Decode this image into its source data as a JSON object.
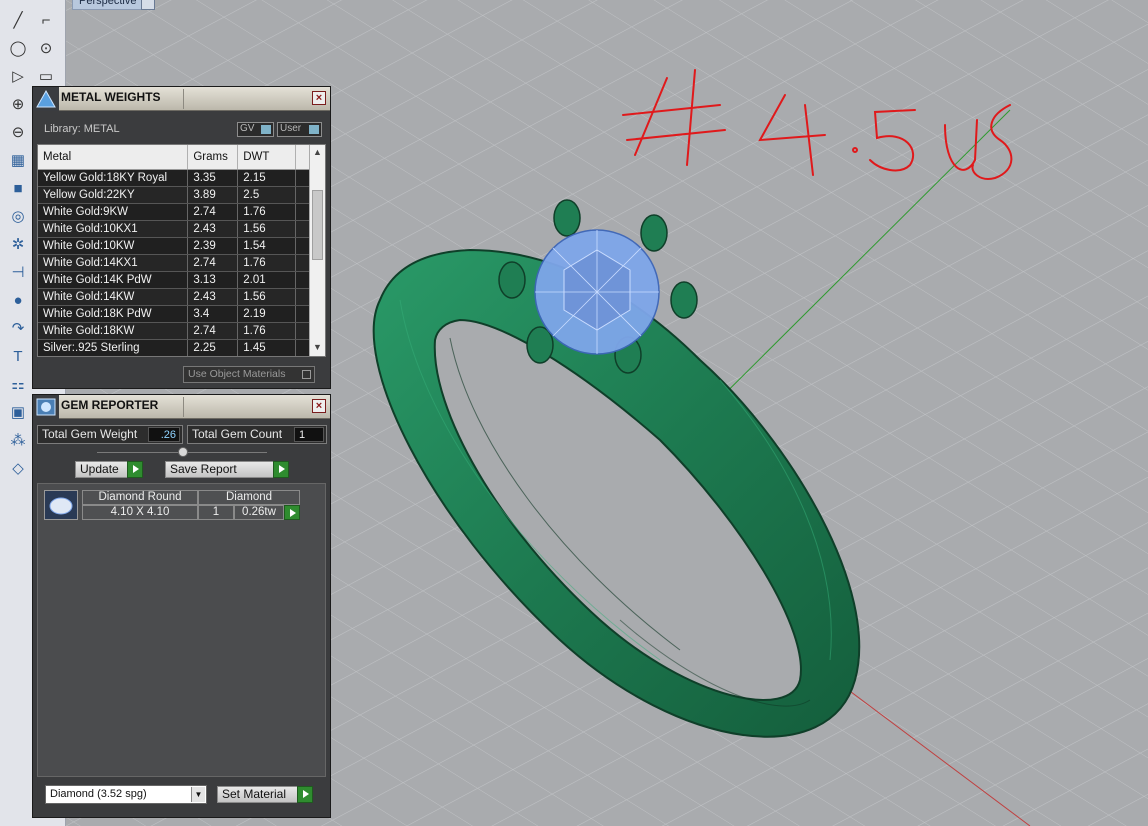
{
  "viewport": {
    "label": "Perspective",
    "annotation": "#4.5US"
  },
  "toolbar": {
    "icons": [
      "polyline-icon",
      "control-points-icon",
      "circle-icon",
      "arc-circle-icon",
      "curve-icon",
      "rectangle-icon",
      "circle-target-icon",
      "ellipse-icon",
      "surface-icon",
      "box-icon",
      "cylinder-icon",
      "gear-icon",
      "transform-icon",
      "boolean-icon",
      "curve-tool-icon",
      "text-icon",
      "array-icon",
      "solid-icon",
      "grid-icon",
      "gem-icon",
      "shape-icon"
    ]
  },
  "metal_panel": {
    "title": "METAL WEIGHTS",
    "library_label": "Library: METAL",
    "gv_label": "GV",
    "user_label": "User",
    "columns": [
      "Metal",
      "Grams",
      "DWT"
    ],
    "rows": [
      [
        "Yellow Gold:18KY Royal",
        "3.35",
        "2.15"
      ],
      [
        "Yellow Gold:22KY",
        "3.89",
        "2.5"
      ],
      [
        "White Gold:9KW",
        "2.74",
        "1.76"
      ],
      [
        "White Gold:10KX1",
        "2.43",
        "1.56"
      ],
      [
        "White Gold:10KW",
        "2.39",
        "1.54"
      ],
      [
        "White Gold:14KX1",
        "2.74",
        "1.76"
      ],
      [
        "White Gold:14K PdW",
        "3.13",
        "2.01"
      ],
      [
        "White Gold:14KW",
        "2.43",
        "1.56"
      ],
      [
        "White Gold:18K PdW",
        "3.4",
        "2.19"
      ],
      [
        "White Gold:18KW",
        "2.74",
        "1.76"
      ],
      [
        "Silver:.925 Sterling",
        "2.25",
        "1.45"
      ]
    ],
    "use_object_materials": "Use Object Materials"
  },
  "gem_panel": {
    "title": "GEM REPORTER",
    "total_weight_label": "Total Gem Weight",
    "total_weight_value": ".26",
    "total_count_label": "Total Gem Count",
    "total_count_value": "1",
    "update_label": "Update",
    "save_report_label": "Save Report",
    "gem": {
      "shape": "Diamond Round",
      "material": "Diamond",
      "size": "4.10 X 4.10",
      "count": "1",
      "weight": "0.26tw"
    },
    "material_select": "Diamond     (3.52 spg)",
    "set_material_label": "Set Material"
  },
  "colors": {
    "ring": "#1e7a52",
    "gem": "#7ea6ea",
    "panel_bg": "#3b3c3e",
    "accent_green": "#2f8c2f"
  }
}
